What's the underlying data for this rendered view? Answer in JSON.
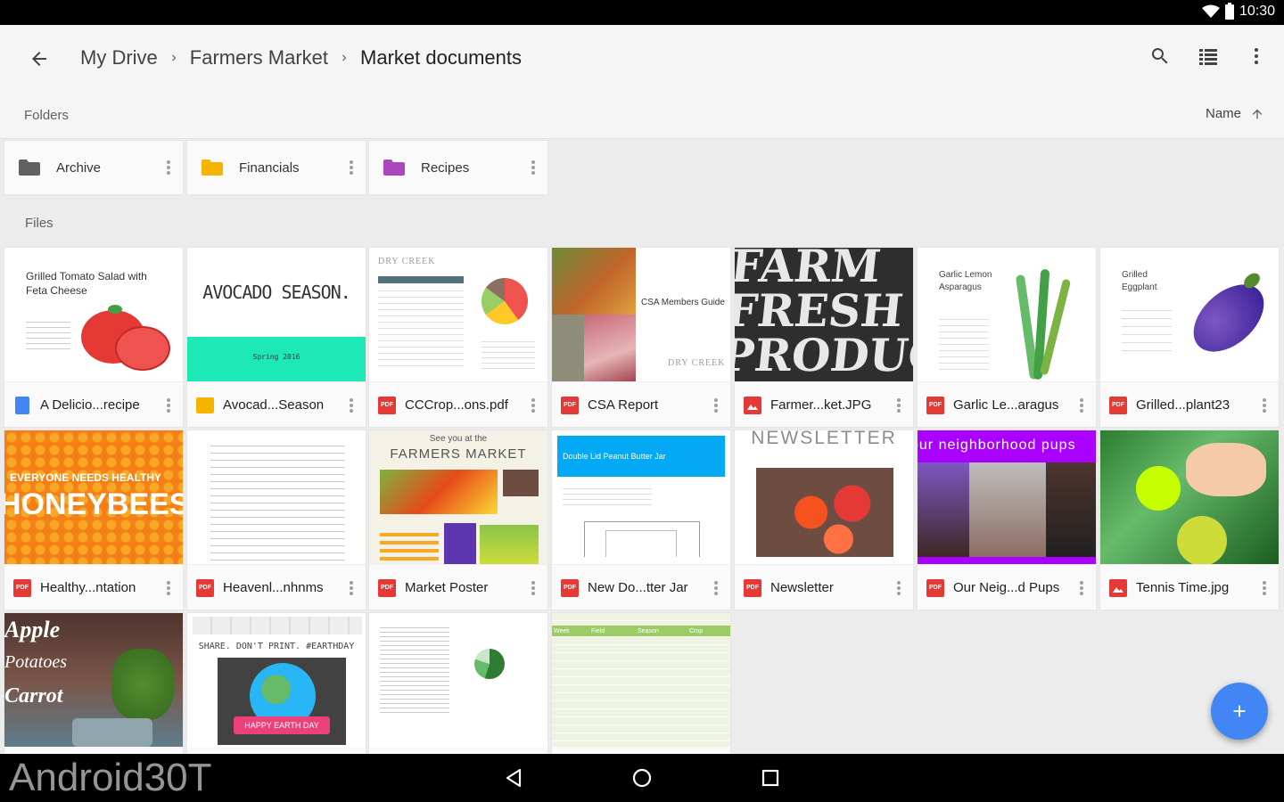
{
  "status": {
    "time": "10:30"
  },
  "toolbar": {
    "breadcrumb": [
      "My Drive",
      "Farmers Market",
      "Market documents"
    ]
  },
  "folders_section": {
    "label": "Folders",
    "sort_label": "Name"
  },
  "folders": [
    {
      "name": "Archive",
      "color": "#616161"
    },
    {
      "name": "Financials",
      "color": "#f4b400"
    },
    {
      "name": "Recipes",
      "color": "#ab47bc"
    }
  ],
  "files_section": {
    "label": "Files"
  },
  "files": [
    {
      "name": "A Delicio...recipe",
      "type": "docs"
    },
    {
      "name": "Avocad...Season",
      "type": "slides"
    },
    {
      "name": "CCCrop...ons.pdf",
      "type": "pdf"
    },
    {
      "name": "CSA Report",
      "type": "pdf"
    },
    {
      "name": "Farmer...ket.JPG",
      "type": "image"
    },
    {
      "name": "Garlic Le...aragus",
      "type": "pdf"
    },
    {
      "name": "Grilled...plant23",
      "type": "pdf"
    },
    {
      "name": "Healthy...ntation",
      "type": "pdf"
    },
    {
      "name": "Heavenl...nhnms",
      "type": "pdf"
    },
    {
      "name": "Market Poster",
      "type": "pdf"
    },
    {
      "name": "New Do...tter Jar",
      "type": "pdf"
    },
    {
      "name": "Newsletter",
      "type": "pdf"
    },
    {
      "name": "Our Neig...d Pups",
      "type": "pdf"
    },
    {
      "name": "Tennis Time.jpg",
      "type": "image"
    }
  ],
  "thumbs": {
    "tomato_title": "Grilled Tomato Salad with Feta Cheese",
    "avocado_title": "AVOCADO SEASON.",
    "avocado_sub": "Spring 2016",
    "dry_creek": "DRY CREEK",
    "csa_title": "CSA Members Guide",
    "farm_fresh": "FARM FRESH PRODUCE",
    "garlic_title": "Garlic Lemon Asparagus",
    "eggplant_title": "Grilled Eggplant",
    "honeybee_line1": "EVERYONE NEEDS HEALTHY",
    "honeybee_line2": "HONEYBEES",
    "poster_top": "See you at the",
    "poster_title": "FARMERS MARKET",
    "jar_title": "Double Lid Peanut Butter Jar",
    "newsletter_title": "NEWSLETTER",
    "pups_title": "our neighborhood pups",
    "earthday": "SHARE. DON'T PRINT. #EARTHDAY",
    "earthday_banner": "HAPPY EARTH DAY",
    "apple_words": [
      "Apple",
      "Potatoes",
      "Carrot"
    ],
    "crop_header": [
      "Week",
      "Field",
      "Season",
      "Crop"
    ]
  },
  "watermark": "Android30T"
}
